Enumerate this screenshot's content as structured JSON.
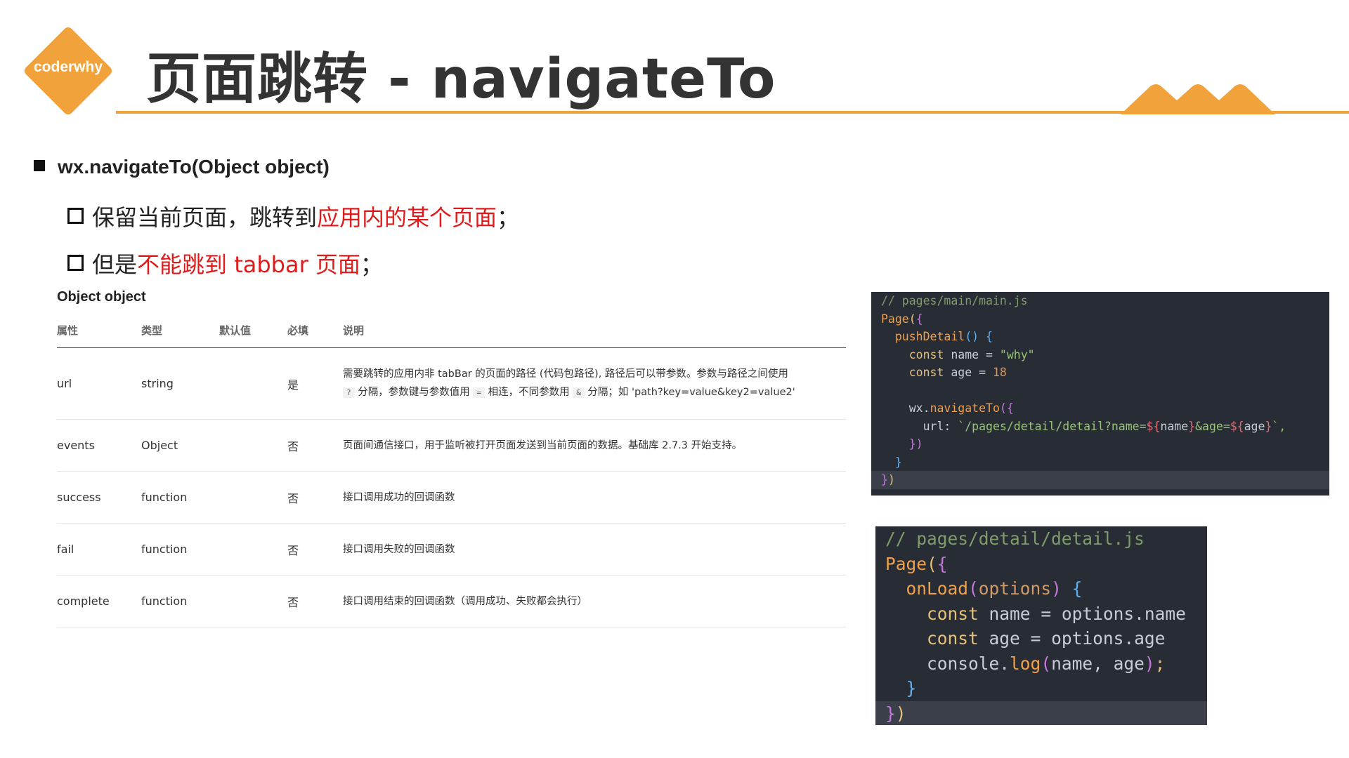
{
  "logo": {
    "text": "coderwhy",
    "color": "#f2a23b"
  },
  "slide": {
    "title": "页面跳转 - navigateTo"
  },
  "bullets": {
    "main": "wx.navigateTo(Object object)",
    "sub1_a": "保留当前页面，跳转到",
    "sub1_b": "应用内的某个页面",
    "sub1_c": "；",
    "sub2_a": "但是",
    "sub2_b": "不能跳到 tabbar 页面",
    "sub2_c": "；"
  },
  "table": {
    "title": "Object object",
    "headers": [
      "属性",
      "类型",
      "默认值",
      "必填",
      "说明"
    ],
    "rows": [
      {
        "name": "url",
        "type": "string",
        "default": "",
        "required": "是",
        "desc_line1": "需要跳转的应用内非 tabBar 的页面的路径 (代码包路径), 路径后可以带参数。参数与路径之间使用",
        "desc_q": "?",
        "desc_a": "分隔，参数键与参数值用",
        "desc_eq": "=",
        "desc_b": "相连，不同参数用",
        "desc_amp": "&",
        "desc_c": "分隔；如 'path?key=value&key2=value2'"
      },
      {
        "name": "events",
        "type": "Object",
        "default": "",
        "required": "否",
        "desc": "页面间通信接口，用于监听被打开页面发送到当前页面的数据。基础库 2.7.3 开始支持。"
      },
      {
        "name": "success",
        "type": "function",
        "default": "",
        "required": "否",
        "desc": "接口调用成功的回调函数"
      },
      {
        "name": "fail",
        "type": "function",
        "default": "",
        "required": "否",
        "desc": "接口调用失败的回调函数"
      },
      {
        "name": "complete",
        "type": "function",
        "default": "",
        "required": "否",
        "desc": "接口调用结束的回调函数（调用成功、失败都会执行）"
      }
    ]
  },
  "code1": {
    "comment": "// pages/main/main.js",
    "page": "Page",
    "method": "pushDetail",
    "const1_kw": "const",
    "const1_name": "name",
    "const1_val": "\"why\"",
    "const2_kw": "const",
    "const2_name": "age",
    "const2_val": "18",
    "wx": "wx",
    "nav": "navigateTo",
    "url_key": "url:",
    "url_a": "`/pages/detail/detail?name=",
    "url_t1": "${",
    "url_v1": "name",
    "url_t1e": "}",
    "url_b": "&age=",
    "url_t2": "${",
    "url_v2": "age",
    "url_t2e": "}",
    "url_c": "`,"
  },
  "code2": {
    "comment": "// pages/detail/detail.js",
    "page": "Page",
    "method": "onLoad",
    "param": "options",
    "c1_kw": "const",
    "c1_name": "name",
    "c1_obj": "options",
    "c1_prop": "name",
    "c2_kw": "const",
    "c2_name": "age",
    "c2_obj": "options",
    "c2_prop": "age",
    "console": "console",
    "log": "log",
    "args": "name, age"
  }
}
